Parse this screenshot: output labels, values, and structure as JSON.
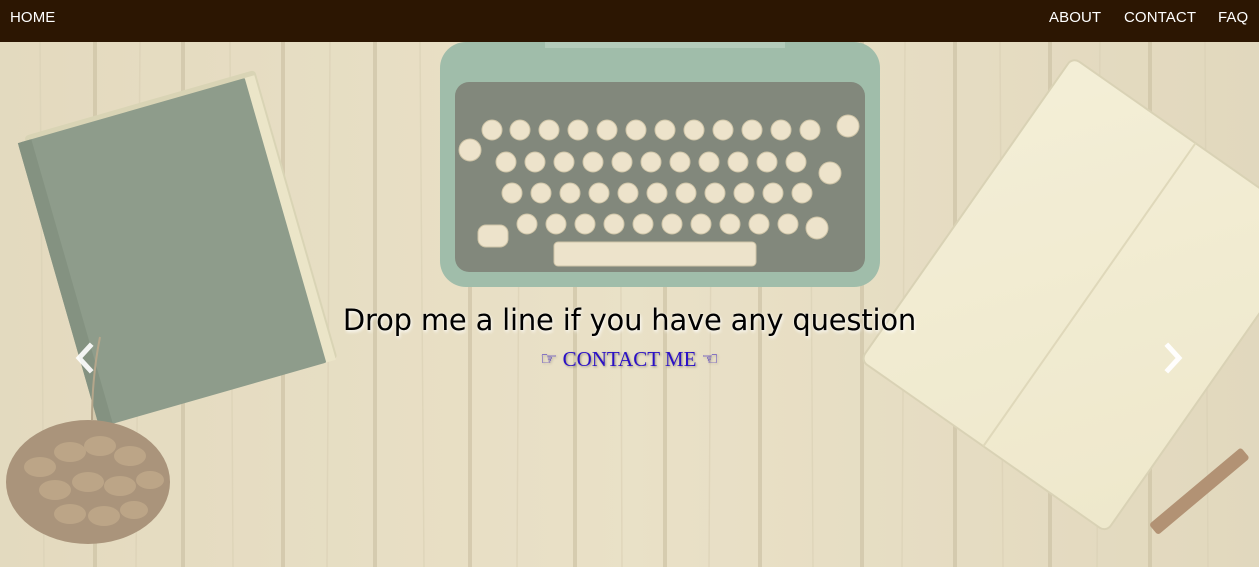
{
  "navbar": {
    "home_label": "HOME",
    "about_label": "ABOUT",
    "contact_label": "CONTACT",
    "faq_label": "FAQ",
    "background_color": "#2c1602"
  },
  "hero": {
    "heading": "Drop me a line if you have any question",
    "contact_link": {
      "left_icon": "hand-pointing-right-icon",
      "label": "CONTACT ME",
      "right_icon": "hand-pointing-left-icon",
      "color": "#2a10c6"
    },
    "prev_control": "chevron-left-icon",
    "next_control": "chevron-right-icon",
    "background_image": "typewriter-desk-photo"
  }
}
